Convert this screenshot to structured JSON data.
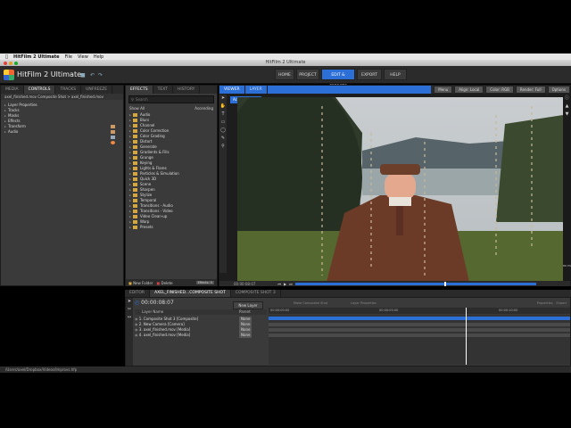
{
  "menubar": {
    "app": "HitFilm 2 Ultimate",
    "items": [
      "File",
      "View",
      "Help"
    ]
  },
  "window_title": "HitFilm 2 Ultimate",
  "brand": "HitFilm 2 Ultimate",
  "nav": [
    "HOME",
    "PROJECT",
    "EDIT & EFFECTS",
    "EXPORT",
    "HELP"
  ],
  "nav_active": "EDIT & EFFECTS",
  "left_panel": {
    "tabs": [
      "MEDIA",
      "CONTROLS",
      "TRACKS",
      "UNFREEZE"
    ],
    "active_tab": "CONTROLS",
    "breadcrumb": "axel_finished.mov Composite Shot  >  axel_finished.mov",
    "items": [
      "Layer Properties",
      "Tracks",
      "Masks",
      "Effects",
      "Transform",
      "Audio"
    ]
  },
  "effects_panel": {
    "tabs": [
      "EFFECTS",
      "TEXT",
      "HISTORY"
    ],
    "active_tab": "EFFECTS",
    "search_placeholder": "Search",
    "filter": "Show All",
    "sort": "Ascending",
    "categories": [
      "Audio",
      "Blurs",
      "Channel",
      "Color Correction",
      "Color Grading",
      "Distort",
      "Generate",
      "Gradients & Fills",
      "Grunge",
      "Keying",
      "Lights & Flares",
      "Particles & Simulation",
      "Quick 3D",
      "Scene",
      "Sharpen",
      "Stylize",
      "Temporal",
      "Transitions - Audio",
      "Transitions - Video",
      "Video Clean-up",
      "Warp",
      "Presets"
    ],
    "new_folder": "New Folder",
    "delete": "Delete",
    "count": "Effects: 0"
  },
  "viewer": {
    "tabs": [
      "VIEWER",
      "LAYER"
    ],
    "active_tab": "VIEWER",
    "camera_label": "Active Camera",
    "options": [
      "Menu",
      "Align: Local",
      "Color: RGB",
      "Render: Full",
      "Options"
    ],
    "timecode": "00:00:08:07",
    "zoom": "89.3%"
  },
  "timeline": {
    "tabs": [
      "EDITOR",
      "AXEL_FINISHED...COMPOSITE SHOT",
      "COMPOSITE SHOT 3"
    ],
    "active_tab": "AXEL_FINISHED...COMPOSITE SHOT",
    "timecode": "00:00:08:07",
    "layer_name_header": "Layer Name",
    "new_layer": "New Layer",
    "parent_header": "Parent",
    "layers": [
      {
        "name": "1. Composite Shot 3 [Composite]",
        "parent": "None"
      },
      {
        "name": "2. New Camera [Camera]",
        "parent": "None"
      },
      {
        "name": "3. axel_finished.mov [Media]",
        "parent": "None"
      },
      {
        "name": "4. axel_finished.mov [Media]",
        "parent": "None"
      }
    ],
    "ruler": [
      "00:00:00:00",
      "00:00:05:00",
      "00:00:10:00"
    ],
    "buttons": [
      "Make Composite Shot",
      "Layer Properties",
      "Properties",
      "Export"
    ]
  },
  "status": "/Users/axel/Dropbox/Videos/Improvs.hfp",
  "colors": {
    "accent": "#2c6fd6",
    "panel": "#3a3a3a",
    "folder": "#d4a640"
  }
}
